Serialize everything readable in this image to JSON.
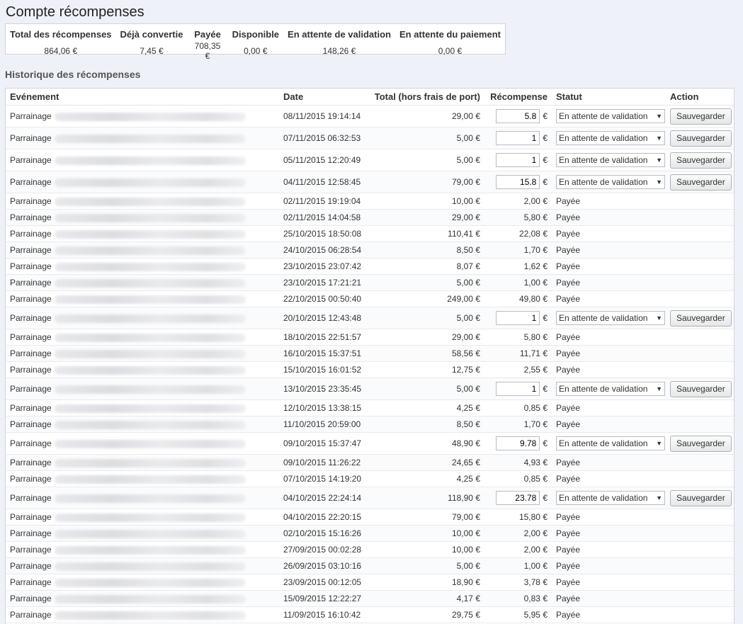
{
  "page_title": "Compte récompenses",
  "summary": {
    "headers": [
      "Total des récompenses",
      "Déjà convertie",
      "Payée",
      "Disponible",
      "En attente de validation",
      "En attente du paiement"
    ],
    "values": [
      "864,06 €",
      "7,45 €",
      "708,35 €",
      "0,00 €",
      "148,26 €",
      "0,00 €"
    ]
  },
  "history": {
    "title": "Historique des récompenses",
    "headers": {
      "event": "Evénement",
      "date": "Date",
      "total": "Total (hors frais de port)",
      "reward": "Récompense",
      "status": "Statut",
      "action": "Action"
    },
    "currency": "€",
    "save_label": "Sauvegarder",
    "pending_label": "En attente de validation",
    "rows": [
      {
        "event": "Parrainage",
        "date": "08/11/2015 19:14:14",
        "total": "29,00 €",
        "reward": "5.8",
        "status": "En attente de validation",
        "editable": true
      },
      {
        "event": "Parrainage",
        "date": "07/11/2015 06:32:53",
        "total": "5,00 €",
        "reward": "1",
        "status": "En attente de validation",
        "editable": true
      },
      {
        "event": "Parrainage",
        "date": "05/11/2015 12:20:49",
        "total": "5,00 €",
        "reward": "1",
        "status": "En attente de validation",
        "editable": true
      },
      {
        "event": "Parrainage",
        "date": "04/11/2015 12:58:45",
        "total": "79,00 €",
        "reward": "15.8",
        "status": "En attente de validation",
        "editable": true
      },
      {
        "event": "Parrainage",
        "date": "02/11/2015 19:19:04",
        "total": "10,00 €",
        "reward": "2,00 €",
        "status": "Payée",
        "editable": false
      },
      {
        "event": "Parrainage",
        "date": "02/11/2015 14:04:58",
        "total": "29,00 €",
        "reward": "5,80 €",
        "status": "Payée",
        "editable": false
      },
      {
        "event": "Parrainage",
        "date": "25/10/2015 18:50:08",
        "total": "110,41 €",
        "reward": "22,08 €",
        "status": "Payée",
        "editable": false
      },
      {
        "event": "Parrainage",
        "date": "24/10/2015 06:28:54",
        "total": "8,50 €",
        "reward": "1,70 €",
        "status": "Payée",
        "editable": false
      },
      {
        "event": "Parrainage",
        "date": "23/10/2015 23:07:42",
        "total": "8,07 €",
        "reward": "1,62 €",
        "status": "Payée",
        "editable": false
      },
      {
        "event": "Parrainage",
        "date": "23/10/2015 17:21:21",
        "total": "5,00 €",
        "reward": "1,00 €",
        "status": "Payée",
        "editable": false
      },
      {
        "event": "Parrainage",
        "date": "22/10/2015 00:50:40",
        "total": "249,00 €",
        "reward": "49,80 €",
        "status": "Payée",
        "editable": false
      },
      {
        "event": "Parrainage",
        "date": "20/10/2015 12:43:48",
        "total": "5,00 €",
        "reward": "1",
        "status": "En attente de validation",
        "editable": true
      },
      {
        "event": "Parrainage",
        "date": "18/10/2015 22:51:57",
        "total": "29,00 €",
        "reward": "5,80 €",
        "status": "Payée",
        "editable": false
      },
      {
        "event": "Parrainage",
        "date": "16/10/2015 15:37:51",
        "total": "58,56 €",
        "reward": "11,71 €",
        "status": "Payée",
        "editable": false
      },
      {
        "event": "Parrainage",
        "date": "15/10/2015 16:01:52",
        "total": "12,75 €",
        "reward": "2,55 €",
        "status": "Payée",
        "editable": false
      },
      {
        "event": "Parrainage",
        "date": "13/10/2015 23:35:45",
        "total": "5,00 €",
        "reward": "1",
        "status": "En attente de validation",
        "editable": true
      },
      {
        "event": "Parrainage",
        "date": "12/10/2015 13:38:15",
        "total": "4,25 €",
        "reward": "0,85 €",
        "status": "Payée",
        "editable": false
      },
      {
        "event": "Parrainage",
        "date": "11/10/2015 20:59:00",
        "total": "8,50 €",
        "reward": "1,70 €",
        "status": "Payée",
        "editable": false
      },
      {
        "event": "Parrainage",
        "date": "09/10/2015 15:37:47",
        "total": "48,90 €",
        "reward": "9.78",
        "status": "En attente de validation",
        "editable": true
      },
      {
        "event": "Parrainage",
        "date": "09/10/2015 11:26:22",
        "total": "24,65 €",
        "reward": "4,93 €",
        "status": "Payée",
        "editable": false
      },
      {
        "event": "Parrainage",
        "date": "07/10/2015 14:19:20",
        "total": "4,25 €",
        "reward": "0,85 €",
        "status": "Payée",
        "editable": false
      },
      {
        "event": "Parrainage",
        "date": "04/10/2015 22:24:14",
        "total": "118,90 €",
        "reward": "23.78",
        "status": "En attente de validation",
        "editable": true
      },
      {
        "event": "Parrainage",
        "date": "04/10/2015 22:20:15",
        "total": "79,00 €",
        "reward": "15,80 €",
        "status": "Payée",
        "editable": false
      },
      {
        "event": "Parrainage",
        "date": "02/10/2015 15:16:26",
        "total": "10,00 €",
        "reward": "2,00 €",
        "status": "Payée",
        "editable": false
      },
      {
        "event": "Parrainage",
        "date": "27/09/2015 00:02:28",
        "total": "10,00 €",
        "reward": "2,00 €",
        "status": "Payée",
        "editable": false
      },
      {
        "event": "Parrainage",
        "date": "26/09/2015 03:10:16",
        "total": "5,00 €",
        "reward": "1,00 €",
        "status": "Payée",
        "editable": false
      },
      {
        "event": "Parrainage",
        "date": "23/09/2015 00:12:05",
        "total": "18,90 €",
        "reward": "3,78 €",
        "status": "Payée",
        "editable": false
      },
      {
        "event": "Parrainage",
        "date": "15/09/2015 12:22:27",
        "total": "4,17 €",
        "reward": "0,83 €",
        "status": "Payée",
        "editable": false
      },
      {
        "event": "Parrainage",
        "date": "11/09/2015 16:10:42",
        "total": "29,75 €",
        "reward": "5,95 €",
        "status": "Payée",
        "editable": false
      }
    ]
  }
}
